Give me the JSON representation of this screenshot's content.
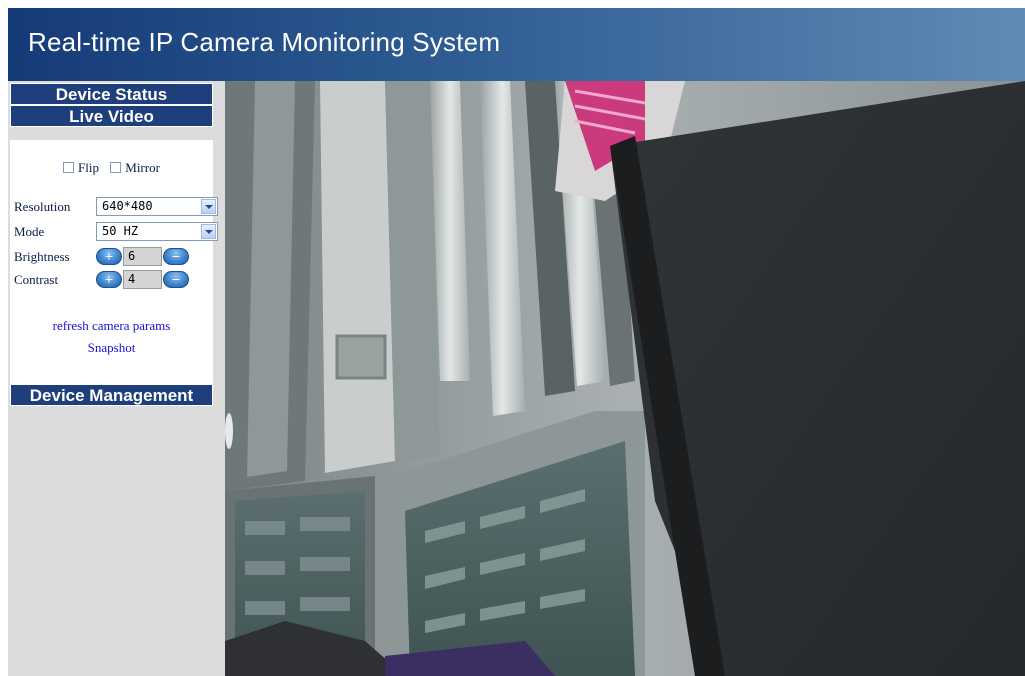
{
  "header": {
    "title": "Real-time IP Camera Monitoring System"
  },
  "sidebar": {
    "device_status": "Device Status",
    "live_video": "Live Video",
    "device_management": "Device Management",
    "controls": {
      "flip_label": "Flip",
      "mirror_label": "Mirror",
      "resolution_label": "Resolution",
      "resolution_value": "640*480",
      "mode_label": "Mode",
      "mode_value": "50 HZ",
      "brightness_label": "Brightness",
      "brightness_value": "6",
      "contrast_label": "Contrast",
      "contrast_value": "4"
    },
    "links": {
      "refresh": "refresh camera params",
      "snapshot": "Snapshot"
    }
  },
  "colors": {
    "header_dark": "#153a78",
    "header_light": "#5f8bb4",
    "section_header": "#1e3f7b",
    "sidebar_bg": "#dcdcdc",
    "link": "#1a0fd6"
  },
  "icons": {
    "increase": "plus-pill-icon",
    "decrease": "minus-pill-icon",
    "dropdown": "chevron-down-icon"
  }
}
